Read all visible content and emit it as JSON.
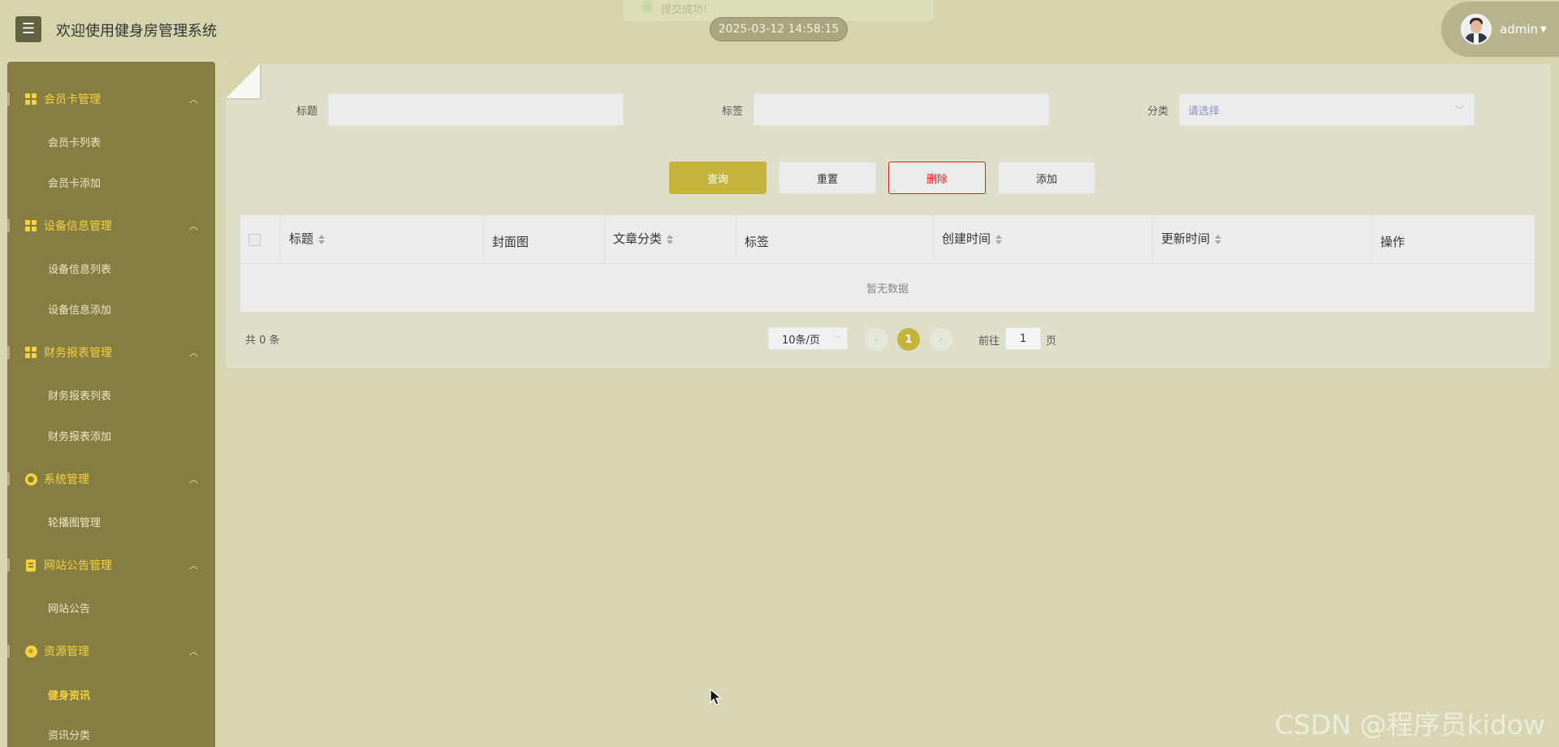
{
  "header": {
    "menu_icon": "hamburger-icon",
    "title": "欢迎使用健身房管理系统",
    "toast_text": "提交成功!",
    "datetime": "2025-03-12 14:58:15",
    "user": {
      "name": "admin",
      "caret": "⌄"
    }
  },
  "sidebar": {
    "groups": [
      {
        "title": "会员卡管理",
        "icon": "grid-icon",
        "items": [
          "会员卡列表",
          "会员卡添加"
        ]
      },
      {
        "title": "设备信息管理",
        "icon": "grid-icon",
        "items": [
          "设备信息列表",
          "设备信息添加"
        ]
      },
      {
        "title": "财务报表管理",
        "icon": "grid-icon",
        "items": [
          "财务报表列表",
          "财务报表添加"
        ]
      },
      {
        "title": "系统管理",
        "icon": "gear-icon",
        "items": [
          "轮播图管理"
        ]
      },
      {
        "title": "网站公告管理",
        "icon": "document-icon",
        "items": [
          "网站公告"
        ]
      },
      {
        "title": "资源管理",
        "icon": "plus-circle-icon",
        "items": [
          "健身资讯",
          "资讯分类"
        ],
        "active_item": "健身资讯"
      }
    ],
    "expand_arrow": "^"
  },
  "search": {
    "title_label": "标题",
    "title_value": "",
    "tag_label": "标签",
    "tag_value": "",
    "category_label": "分类",
    "category_placeholder": "请选择"
  },
  "actions": {
    "query": "查询",
    "reset": "重置",
    "delete": "删除",
    "add": "添加"
  },
  "table": {
    "columns": [
      "标题",
      "封面图",
      "文章分类",
      "标签",
      "创建时间",
      "更新时间",
      "操作"
    ],
    "sortable": [
      true,
      false,
      true,
      false,
      true,
      true,
      false
    ],
    "rows": [],
    "empty_text": "暂无数据"
  },
  "pagination": {
    "total_text": "共 0 条",
    "page_size": "10条/页",
    "current_page": "1",
    "goto_prefix": "前往",
    "goto_value": "1",
    "goto_suffix": "页",
    "prev": "‹",
    "next": "›"
  },
  "watermark": "CSDN @程序员kidow",
  "colors": {
    "accent": "#c4b33d",
    "sidebar": "#857d41",
    "menu_title": "#f4d23e",
    "danger": "#e02424"
  }
}
